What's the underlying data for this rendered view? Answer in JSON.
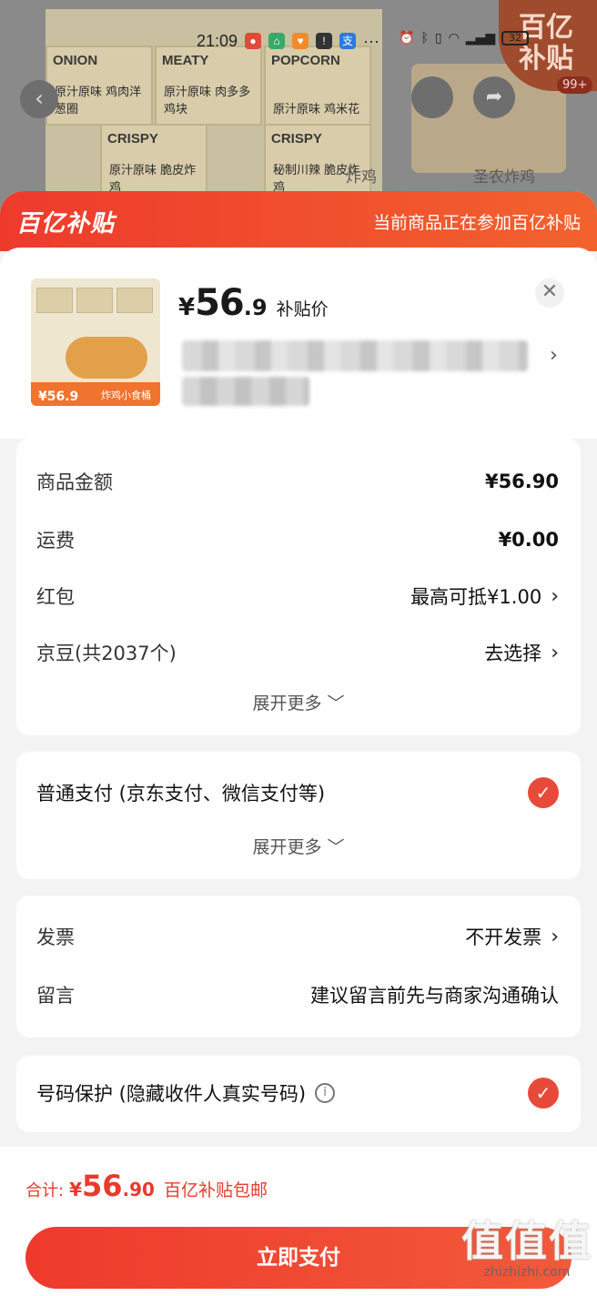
{
  "status_bar": {
    "time": "21:09",
    "battery": "32"
  },
  "background": {
    "box_labels": [
      "ONION",
      "MEATY",
      "POPCORN",
      "CRISPY",
      "CRISPY"
    ],
    "box_subs": [
      "原汁原味 鸡肉洋葱圈",
      "原汁原味 肉多多鸡块",
      "原汁原味 鸡米花",
      "原汁原味 脆皮炸鸡",
      "秘制川辣 脆皮炸鸡"
    ],
    "caption": "圣农炸鸡",
    "caption_left": "炸鸡",
    "badge_logo": "百亿补贴",
    "badge_count": "99+"
  },
  "banner": {
    "logo": "百亿补贴",
    "note": "当前商品正在参加百亿补贴"
  },
  "product": {
    "price_symbol": "¥",
    "price_int": "56",
    "price_dec": ".9",
    "price_label": "补贴价",
    "thumb_price": "¥56.9",
    "thumb_tag": "炸鸡小食桶"
  },
  "summary": {
    "goods_label": "商品金额",
    "goods_value": "¥56.90",
    "freight_label": "运费",
    "freight_value": "¥0.00",
    "redpacket_label": "红包",
    "redpacket_value": "最高可抵¥1.00",
    "jingdou_label": "京豆(共2037个)",
    "jingdou_value": "去选择",
    "more": "展开更多"
  },
  "payment": {
    "label": "普通支付 (京东支付、微信支付等)",
    "more": "展开更多"
  },
  "extra": {
    "invoice_label": "发票",
    "invoice_value": "不开发票",
    "message_label": "留言",
    "message_placeholder": "建议留言前先与商家沟通确认"
  },
  "privacy": {
    "label": "号码保护 (隐藏收件人真实号码)"
  },
  "footer": {
    "total_label": "合计:",
    "total_symbol": "¥",
    "total_int": "56",
    "total_dec": ".90",
    "total_note": "百亿补贴包邮",
    "pay_button": "立即支付"
  },
  "watermark": {
    "brand": "值值值",
    "site": "zhizhizhi.com"
  },
  "colors": {
    "accent": "#ee3a2c",
    "check": "#e84a3a"
  }
}
